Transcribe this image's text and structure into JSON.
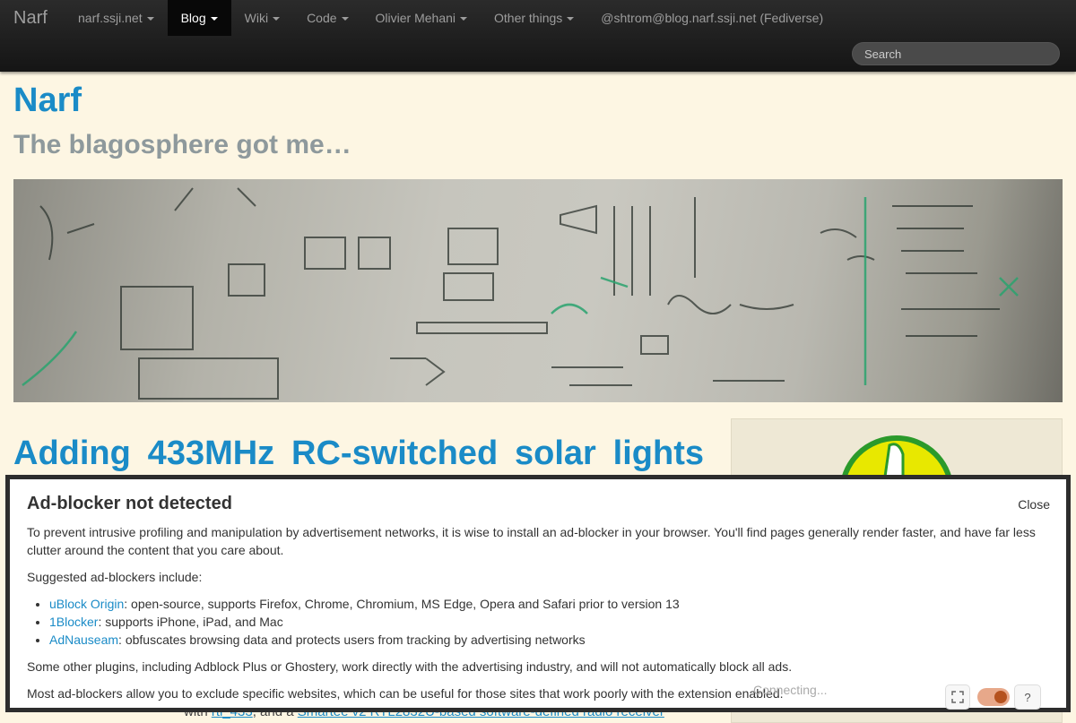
{
  "nav": {
    "brand": "Narf",
    "items": [
      {
        "label": "narf.ssji.net",
        "dropdown": true,
        "active": false
      },
      {
        "label": "Blog",
        "dropdown": true,
        "active": true
      },
      {
        "label": "Wiki",
        "dropdown": true,
        "active": false
      },
      {
        "label": "Code",
        "dropdown": true,
        "active": false
      },
      {
        "label": "Olivier Mehani",
        "dropdown": true,
        "active": false
      },
      {
        "label": "Other things",
        "dropdown": true,
        "active": false
      },
      {
        "label": "@shtrom@blog.narf.ssji.net (Fediverse)",
        "dropdown": false,
        "active": false
      }
    ],
    "search_placeholder": "Search"
  },
  "header": {
    "title": "Narf",
    "subtitle": "The blagosphere got me…"
  },
  "article": {
    "title": "Adding 433MHz RC-switched solar lights",
    "snippet_prefix": "with ",
    "snippet_link1": "rtl_433",
    "snippet_mid": ", and a ",
    "snippet_link2": "Smartee v2 RTL2832U-based software-defined radio receiver"
  },
  "modal": {
    "title": "Ad-blocker not detected",
    "close_label": "Close",
    "intro": "To prevent intrusive profiling and manipulation by advertisement networks, it is wise to install an ad-blocker in your browser. You'll find pages generally render faster, and have far less clutter around the content that you care about.",
    "suggested": "Suggested ad-blockers include:",
    "blockers": [
      {
        "name": "uBlock Origin",
        "desc": ": open-source, supports Firefox, Chrome, Chromium, MS Edge, Opera and Safari prior to version 13"
      },
      {
        "name": "1Blocker",
        "desc": ": supports iPhone, iPad, and Mac"
      },
      {
        "name": "AdNauseam",
        "desc": ": obfuscates browsing data and protects users from tracking by advertising networks"
      }
    ],
    "other_plugins": "Some other plugins, including Adblock Plus or Ghostery, work directly with the advertising industry, and will not automatically block all ads.",
    "exclude": "Most ad-blockers allow you to exclude specific websites, which can be useful for those sites that work poorly with the extension enabled."
  },
  "widget": {
    "status": "Connecting...",
    "help_label": "?"
  },
  "colors": {
    "accent": "#1a8bc7",
    "background": "#fdf6e3",
    "navbar": "#222222",
    "toggle_on": "#b5521f"
  }
}
